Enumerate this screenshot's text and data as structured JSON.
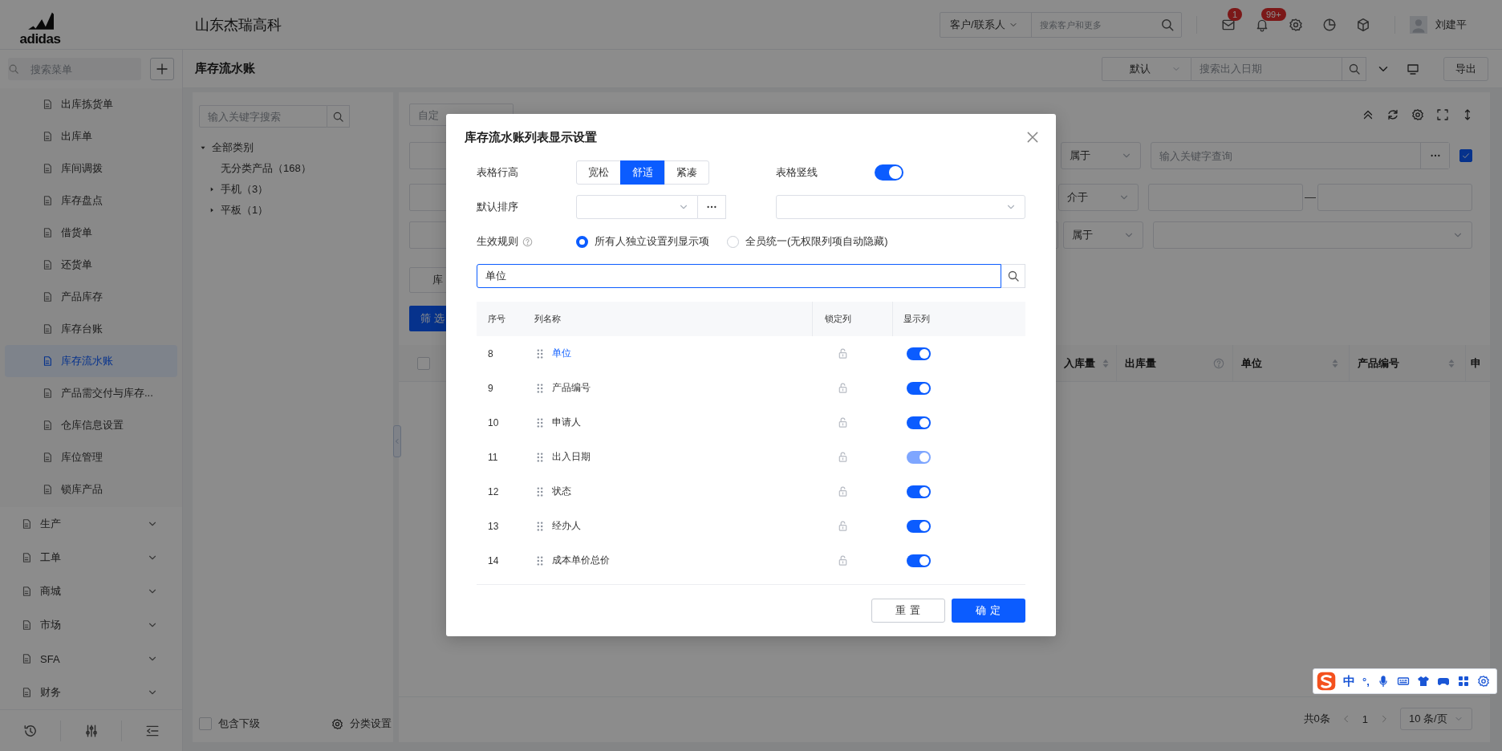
{
  "topbar": {
    "logo_text": "adidas",
    "company": "山东杰瑞高科",
    "search_scope": "客户/联系人",
    "search_placeholder": "搜索客户和更多",
    "notifications": [
      {
        "kind": "mail",
        "badge": "1"
      },
      {
        "kind": "bell",
        "badge": "99+"
      }
    ],
    "user": "刘建平"
  },
  "sidebar": {
    "search_placeholder": "搜索菜单",
    "items": [
      {
        "label": "出库拣货单",
        "selected": false
      },
      {
        "label": "出库单",
        "selected": false
      },
      {
        "label": "库间调拨",
        "selected": false
      },
      {
        "label": "库存盘点",
        "selected": false
      },
      {
        "label": "借货单",
        "selected": false
      },
      {
        "label": "还货单",
        "selected": false
      },
      {
        "label": "产品库存",
        "selected": false
      },
      {
        "label": "库存台账",
        "selected": false
      },
      {
        "label": "库存流水账",
        "selected": true
      },
      {
        "label": "产品需交付与库存...",
        "selected": false
      },
      {
        "label": "仓库信息设置",
        "selected": false
      },
      {
        "label": "库位管理",
        "selected": false
      },
      {
        "label": "锁库产品",
        "selected": false
      }
    ],
    "groups": [
      {
        "label": "生产",
        "expanded": false
      },
      {
        "label": "工单",
        "expanded": false
      },
      {
        "label": "商城",
        "expanded": false
      },
      {
        "label": "市场",
        "expanded": false
      },
      {
        "label": "SFA",
        "expanded": false
      },
      {
        "label": "财务",
        "expanded": false
      }
    ]
  },
  "page": {
    "title": "库存流水账",
    "view_select": "默认",
    "date_search_placeholder": "搜索出入日期",
    "export": "导出"
  },
  "category_panel": {
    "search_placeholder": "输入关键字搜索",
    "tree": [
      {
        "label": "全部类别",
        "expanded": true,
        "children": [
          {
            "label": "无分类产品（168）"
          },
          {
            "label": "手机（3）",
            "expanded": false
          },
          {
            "label": "平板（1）",
            "expanded": false
          }
        ]
      }
    ],
    "include_children": {
      "label": "包含下级",
      "checked": false
    },
    "settings": "分类设置"
  },
  "query_panel": {
    "query_placeholder": "自定",
    "tab_stub": "库",
    "filter_button": "筛 选",
    "filters": [
      {
        "kind": "keyword",
        "operator": "属于",
        "placeholder": "输入关键字查询",
        "checked": true
      },
      {
        "kind": "range",
        "operator": "介于"
      },
      {
        "kind": "select",
        "operator": "属于"
      }
    ]
  },
  "table": {
    "header_checked": false,
    "columns": [
      {
        "label": "入库量",
        "kind": "sortable"
      },
      {
        "label": "出库量",
        "kind": "help"
      },
      {
        "label": "单位",
        "kind": "sortable"
      },
      {
        "label": "产品编号",
        "kind": "sortable"
      },
      {
        "label": "申",
        "kind": "plain"
      }
    ]
  },
  "pagination": {
    "total": "共0条",
    "page": "1",
    "page_size": "10 条/页"
  },
  "modal": {
    "title": "库存流水账列表显示设置",
    "row_height": {
      "label": "表格行高",
      "options": [
        {
          "label": "宽松",
          "selected": false
        },
        {
          "label": "舒适",
          "selected": true
        },
        {
          "label": "紧凑",
          "selected": false
        }
      ]
    },
    "vertical_lines": {
      "label": "表格竖线",
      "on": true
    },
    "default_sort": {
      "label": "默认排序"
    },
    "rule": {
      "label": "生效规则",
      "options": [
        {
          "label": "所有人独立设置列显示项",
          "selected": true
        },
        {
          "label": "全员统一(无权限列项自动隐藏)",
          "selected": false
        }
      ]
    },
    "search_value": "单位",
    "columns": [
      "序号",
      "列名称",
      "锁定列",
      "显示列"
    ],
    "rows": [
      {
        "index": "8",
        "name": "单位",
        "matched": true,
        "locked": false,
        "visible": true,
        "disabled": false
      },
      {
        "index": "9",
        "name": "产品编号",
        "matched": false,
        "locked": false,
        "visible": true,
        "disabled": false
      },
      {
        "index": "10",
        "name": "申请人",
        "matched": false,
        "locked": false,
        "visible": true,
        "disabled": false
      },
      {
        "index": "11",
        "name": "出入日期",
        "matched": false,
        "locked": false,
        "visible": true,
        "disabled": true
      },
      {
        "index": "12",
        "name": "状态",
        "matched": false,
        "locked": false,
        "visible": true,
        "disabled": false
      },
      {
        "index": "13",
        "name": "经办人",
        "matched": false,
        "locked": false,
        "visible": true,
        "disabled": false
      },
      {
        "index": "14",
        "name": "成本单价总价",
        "matched": false,
        "locked": false,
        "visible": true,
        "disabled": false
      }
    ],
    "buttons": {
      "reset": "重 置",
      "confirm": "确 定"
    }
  },
  "ime_toolbar": {
    "language": "中",
    "punctuation": "°,"
  }
}
